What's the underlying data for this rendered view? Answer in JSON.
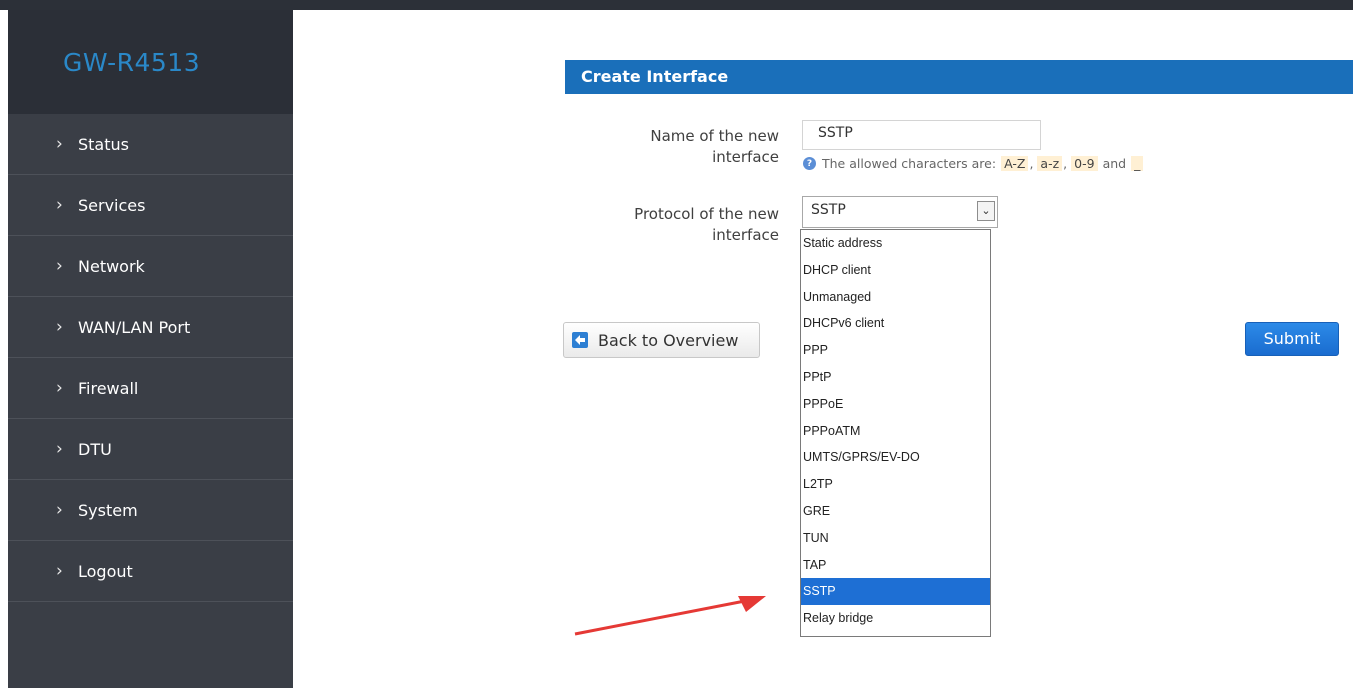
{
  "brand": "GW-R4513",
  "sidebar": {
    "items": [
      {
        "label": "Status"
      },
      {
        "label": "Services"
      },
      {
        "label": "Network"
      },
      {
        "label": "WAN/LAN Port"
      },
      {
        "label": "Firewall"
      },
      {
        "label": "DTU"
      },
      {
        "label": "System"
      },
      {
        "label": "Logout"
      }
    ]
  },
  "section": {
    "title": "Create Interface"
  },
  "form": {
    "name_label_line1": "Name of the new",
    "name_label_line2": "interface",
    "name_value": "SSTP",
    "hint": {
      "prefix": "The allowed characters are:",
      "chars": [
        "A-Z",
        "a-z",
        "0-9"
      ],
      "conj": "and",
      "last": "_"
    },
    "protocol_label_line1": "Protocol of the new",
    "protocol_label_line2": "interface",
    "protocol_selected": "SSTP",
    "protocol_options": [
      "Static address",
      "DHCP client",
      "Unmanaged",
      "DHCPv6 client",
      "PPP",
      "PPtP",
      "PPPoE",
      "PPPoATM",
      "UMTS/GPRS/EV-DO",
      "L2TP",
      "GRE",
      "TUN",
      "TAP",
      "SSTP",
      "Relay bridge"
    ]
  },
  "buttons": {
    "back": "Back to Overview",
    "submit": "Submit"
  },
  "colors": {
    "accent": "#1a6fba",
    "sidebar": "#3a3e46",
    "selected_option": "#1e6fd4",
    "annotation_arrow": "#e53935"
  }
}
